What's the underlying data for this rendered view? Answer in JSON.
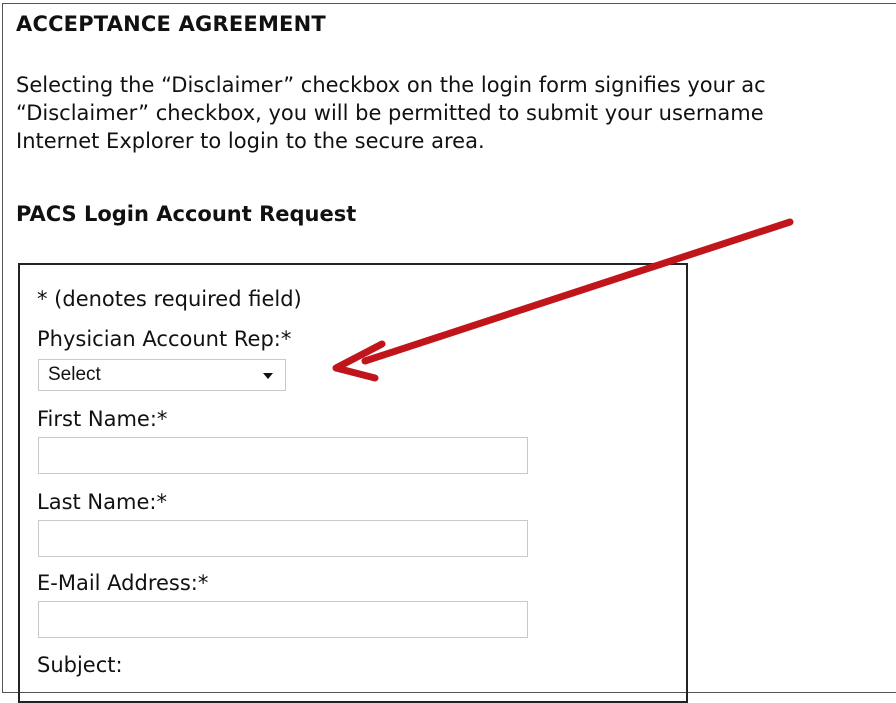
{
  "agreement": {
    "title": "ACCEPTANCE AGREEMENT",
    "lines": [
      "Selecting the “Disclaimer” checkbox on the login form signifies your ac",
      "“Disclaimer” checkbox, you will be permitted to submit your username",
      "Internet Explorer to login to the secure area."
    ]
  },
  "form": {
    "title": "PACS Login Account Request",
    "required_note": "* (denotes required field)",
    "physician_rep": {
      "label": "Physician Account Rep:*",
      "selected": "Select"
    },
    "first_name": {
      "label": "First Name:*",
      "value": ""
    },
    "last_name": {
      "label": "Last Name:*",
      "value": ""
    },
    "email": {
      "label": "E-Mail Address:*",
      "value": ""
    },
    "subject": {
      "label": "Subject:"
    }
  },
  "colors": {
    "annotation_arrow": "#c0151b"
  },
  "icons": {
    "dropdown": "chevron-down-icon",
    "annotation": "red-arrow-icon"
  }
}
